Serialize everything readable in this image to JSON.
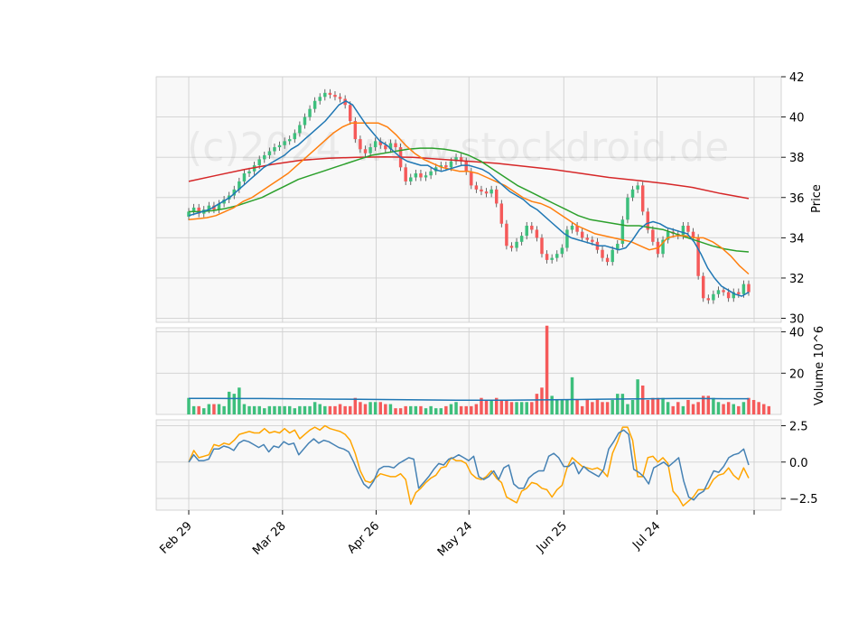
{
  "chart_data": {
    "type": "candlestick",
    "watermark": "(c)2024 www.stockdroid.de",
    "x_ticks": [
      "Feb 29",
      "Mar 28",
      "Apr 26",
      "May 24",
      "Jun 25",
      "Jul 24"
    ],
    "colors": {
      "up": "#3dbf7c",
      "down": "#f55a5a",
      "sma_short": "#1f77b4",
      "sma_mid": "#ff7f0e",
      "sma_long": "#2ca02c",
      "sma_longest": "#d62728",
      "volume_avg": "#1f77b4",
      "indicator_a": "#4682b4",
      "indicator_b": "#ffa500",
      "panel_bg": "#f8f8f8",
      "grid": "#d0d0d0"
    },
    "price_panel": {
      "ylabel": "Price",
      "ylim": [
        29.8,
        42.0
      ],
      "yticks": [
        30,
        32,
        34,
        36,
        38,
        40,
        42
      ],
      "close": [
        35.3,
        35.5,
        35.2,
        35.4,
        35.6,
        35.4,
        35.7,
        35.9,
        36.1,
        36.4,
        36.8,
        37.2,
        37.3,
        37.6,
        37.9,
        38.1,
        38.3,
        38.5,
        38.6,
        38.8,
        38.9,
        39.2,
        39.6,
        40.0,
        40.4,
        40.8,
        41.0,
        41.2,
        41.1,
        41.0,
        40.9,
        40.6,
        39.8,
        38.9,
        38.4,
        38.2,
        38.5,
        38.8,
        38.6,
        38.4,
        38.7,
        38.5,
        37.5,
        36.8,
        37.0,
        37.2,
        37.0,
        37.1,
        37.3,
        37.5,
        37.6,
        37.5,
        37.8,
        38.0,
        37.8,
        37.3,
        36.6,
        36.4,
        36.3,
        36.2,
        36.4,
        35.7,
        34.7,
        33.6,
        33.5,
        33.8,
        34.1,
        34.6,
        34.4,
        34.0,
        33.2,
        32.9,
        33.0,
        33.2,
        33.5,
        34.4,
        34.6,
        34.3,
        34.0,
        33.9,
        33.8,
        33.4,
        33.0,
        32.8,
        33.4,
        33.7,
        34.9,
        36.0,
        36.4,
        36.6,
        35.3,
        34.4,
        33.8,
        33.2,
        33.9,
        34.3,
        34.2,
        34.1,
        34.6,
        34.3,
        34.0,
        32.1,
        31.0,
        30.9,
        31.2,
        31.4,
        31.3,
        31.0,
        31.3,
        31.2,
        31.7,
        31.3
      ],
      "sma_short": [
        35.1,
        35.2,
        35.3,
        35.4,
        35.6,
        35.8,
        36.0,
        36.3,
        36.6,
        36.9,
        37.2,
        37.5,
        37.7,
        37.9,
        38.1,
        38.4,
        38.6,
        38.9,
        39.2,
        39.5,
        39.8,
        40.2,
        40.6,
        40.8,
        40.6,
        40.1,
        39.6,
        39.2,
        38.8,
        38.6,
        38.3,
        38.0,
        37.8,
        37.7,
        37.6,
        37.6,
        37.4,
        37.3,
        37.4,
        37.5,
        37.6,
        37.6,
        37.5,
        37.4,
        37.2,
        36.9,
        36.6,
        36.3,
        36.1,
        35.9,
        35.6,
        35.4,
        35.1,
        34.8,
        34.5,
        34.2,
        34.0,
        33.9,
        33.8,
        33.7,
        33.6,
        33.6,
        33.5,
        33.4,
        33.5,
        33.9,
        34.4,
        34.7,
        34.8,
        34.7,
        34.5,
        34.4,
        34.3,
        34.2,
        33.8,
        33.2,
        32.5,
        32.0,
        31.6,
        31.4,
        31.2,
        31.1,
        31.3
      ],
      "sma_mid": [
        34.9,
        34.95,
        35.0,
        35.1,
        35.3,
        35.5,
        35.8,
        36.0,
        36.3,
        36.6,
        36.9,
        37.2,
        37.6,
        38.0,
        38.4,
        38.8,
        39.2,
        39.5,
        39.7,
        39.7,
        39.7,
        39.7,
        39.5,
        39.1,
        38.6,
        38.2,
        37.9,
        37.7,
        37.5,
        37.4,
        37.3,
        37.3,
        37.2,
        37.0,
        36.8,
        36.6,
        36.3,
        36.0,
        35.8,
        35.7,
        35.5,
        35.2,
        34.9,
        34.6,
        34.4,
        34.2,
        34.1,
        34.0,
        33.9,
        33.8,
        33.6,
        33.4,
        33.5,
        34.0,
        34.1,
        34.1,
        34.0,
        34.0,
        33.8,
        33.5,
        33.1,
        32.6,
        32.2
      ],
      "sma_long": [
        35.3,
        35.3,
        35.35,
        35.45,
        35.6,
        35.8,
        36.0,
        36.3,
        36.6,
        36.9,
        37.1,
        37.3,
        37.5,
        37.7,
        37.9,
        38.1,
        38.2,
        38.3,
        38.4,
        38.45,
        38.45,
        38.4,
        38.3,
        38.1,
        37.8,
        37.4,
        37.0,
        36.6,
        36.3,
        36.0,
        35.7,
        35.4,
        35.1,
        34.9,
        34.8,
        34.7,
        34.6,
        34.6,
        34.5,
        34.4,
        34.2,
        34.0,
        33.8,
        33.6,
        33.45,
        33.35,
        33.3
      ],
      "sma_longest": [
        36.8,
        37.1,
        37.4,
        37.65,
        37.85,
        37.95,
        38.0,
        38.02,
        38.0,
        37.9,
        37.8,
        37.7,
        37.55,
        37.4,
        37.2,
        37.0,
        36.85,
        36.7,
        36.5,
        36.2,
        35.95
      ],
      "last_value": 31.3
    },
    "volume_panel": {
      "ylabel": "Volume 10^6",
      "ylim": [
        0,
        42
      ],
      "yticks": [
        20,
        40
      ],
      "values": [
        8,
        4,
        4,
        3,
        5,
        5,
        5,
        4,
        11,
        10,
        13,
        5,
        4,
        4,
        4,
        3,
        4,
        4,
        4,
        4,
        4,
        3,
        4,
        4,
        4,
        6,
        5,
        4,
        4,
        4,
        5,
        4,
        4,
        8,
        6,
        5,
        6,
        6,
        6,
        5,
        5,
        3,
        3,
        4,
        4,
        4,
        4,
        3,
        4,
        3,
        3,
        4,
        5,
        6,
        4,
        4,
        4,
        5,
        8,
        7,
        7,
        8,
        7,
        7,
        6,
        6,
        6,
        6,
        6,
        10,
        13,
        43,
        9,
        7,
        7,
        7,
        18,
        7,
        4,
        7,
        6,
        7,
        6,
        6,
        7,
        10,
        10,
        5,
        7,
        17,
        14,
        7,
        8,
        8,
        8,
        6,
        4,
        6,
        4,
        7,
        5,
        6,
        9,
        9,
        8,
        6,
        5,
        6,
        5,
        4,
        6,
        8,
        7,
        6,
        5,
        4
      ],
      "avg": [
        7.8,
        7.8,
        7.7,
        7.7,
        7.6,
        7.5,
        7.4,
        7.3,
        7.2,
        7.1,
        7.0,
        6.9,
        6.9,
        6.9,
        7.0,
        7.1,
        7.2,
        7.4,
        7.5,
        7.6,
        7.7,
        7.7,
        7.6,
        7.6
      ]
    },
    "indicator_panel": {
      "ylim": [
        -3.3,
        2.9
      ],
      "yticks": [
        2.5,
        0.0,
        -2.5
      ],
      "ytick_labels": [
        "2.5",
        "0.0",
        "−2.5"
      ],
      "line_a": [
        0.0,
        0.5,
        0.1,
        0.1,
        0.2,
        0.9,
        0.9,
        1.1,
        1.0,
        0.8,
        1.3,
        1.5,
        1.4,
        1.2,
        1.0,
        1.2,
        0.7,
        1.1,
        1.0,
        1.4,
        1.2,
        1.3,
        0.5,
        0.9,
        1.3,
        1.6,
        1.3,
        1.5,
        1.4,
        1.2,
        1.0,
        0.9,
        0.7,
        0.0,
        -0.8,
        -1.5,
        -1.8,
        -1.3,
        -0.5,
        -0.3,
        -0.3,
        -0.4,
        -0.1,
        0.1,
        0.3,
        0.2,
        -1.8,
        -1.4,
        -1.0,
        -0.5,
        -0.1,
        -0.2,
        0.2,
        0.3,
        0.5,
        0.3,
        0.1,
        0.4,
        -1.0,
        -1.2,
        -1.0,
        -0.6,
        -1.2,
        -0.4,
        -0.2,
        -1.5,
        -1.8,
        -1.8,
        -1.1,
        -0.8,
        -0.6,
        -0.6,
        0.4,
        0.6,
        0.3,
        -0.3,
        -0.3,
        0.0,
        -0.8,
        -0.3,
        -0.6,
        -0.8,
        -1.0,
        -0.5,
        0.9,
        1.4,
        2.0,
        2.2,
        1.9,
        -0.5,
        -0.7,
        -1.0,
        -1.5,
        -0.4,
        -0.2,
        0.0,
        -0.3,
        0.0,
        0.3,
        -1.3,
        -2.4,
        -2.6,
        -2.2,
        -2.0,
        -1.3,
        -0.6,
        -0.7,
        -0.3,
        0.3,
        0.5,
        0.6,
        0.9,
        -0.2
      ],
      "line_b": [
        0.0,
        0.8,
        0.3,
        0.4,
        0.5,
        1.2,
        1.1,
        1.3,
        1.2,
        1.5,
        1.9,
        2.0,
        2.1,
        2.0,
        2.0,
        2.3,
        2.0,
        2.1,
        2.0,
        2.3,
        2.0,
        2.2,
        1.6,
        1.9,
        2.2,
        2.4,
        2.2,
        2.5,
        2.3,
        2.2,
        2.1,
        1.9,
        1.5,
        0.6,
        -0.6,
        -1.3,
        -1.4,
        -1.1,
        -0.8,
        -0.9,
        -1.0,
        -1.0,
        -0.8,
        -1.2,
        -2.9,
        -2.1,
        -1.8,
        -1.4,
        -1.1,
        -0.9,
        -0.4,
        -0.3,
        0.3,
        0.1,
        0.1,
        -0.1,
        -0.8,
        -1.1,
        -1.2,
        -1.0,
        -0.6,
        -1.1,
        -1.4,
        -2.4,
        -2.6,
        -2.8,
        -2.0,
        -1.8,
        -1.4,
        -1.5,
        -1.8,
        -1.9,
        -2.4,
        -1.9,
        -1.6,
        -0.4,
        0.3,
        0.0,
        -0.3,
        -0.4,
        -0.5,
        -0.4,
        -0.6,
        -1.0,
        0.6,
        1.4,
        2.4,
        2.4,
        1.5,
        -1.0,
        -1.0,
        0.3,
        0.4,
        0.0,
        0.3,
        -0.1,
        -2.0,
        -2.4,
        -3.0,
        -2.7,
        -2.4,
        -1.9,
        -1.9,
        -1.8,
        -1.2,
        -0.9,
        -0.8,
        -0.4,
        -0.9,
        -1.2,
        -0.4,
        -1.1
      ]
    }
  }
}
